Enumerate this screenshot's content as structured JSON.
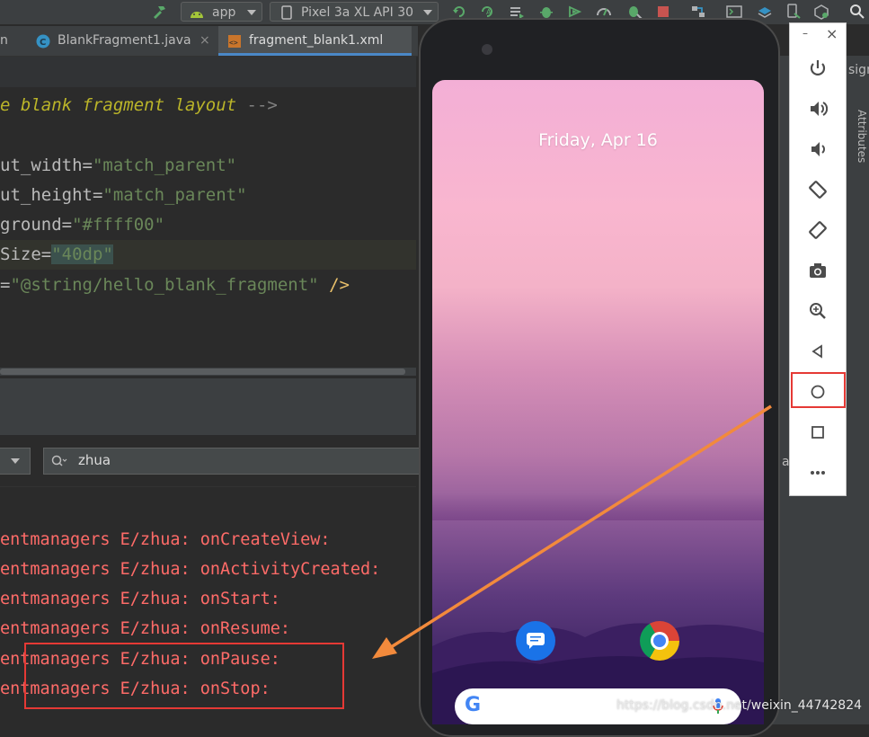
{
  "toolbar": {
    "run_config": "app",
    "device": "Pixel 3a XL API 30"
  },
  "tabs": [
    {
      "label": "n",
      "active": false
    },
    {
      "label": "BlankFragment1.java",
      "active": false
    },
    {
      "label": "fragment_blank1.xml",
      "active": true
    }
  ],
  "editor": {
    "lines": [
      {
        "c1": "e blank fragment layout",
        "c2": " -->"
      },
      {
        "a": "ut_width",
        "eq": "=",
        "s": "\"match_parent\""
      },
      {
        "a": "ut_height",
        "eq": "=",
        "s": "\"match_parent\""
      },
      {
        "a": "ground",
        "eq": "=",
        "s": "\"#ffff00\""
      },
      {
        "a": "Size",
        "eq": "=",
        "s": "\"40dp\""
      },
      {
        "a": "",
        "eq": "=",
        "s": "\"@string/hello_blank_fragment\"",
        "t": " />"
      }
    ]
  },
  "logcat": {
    "search_value": "zhua",
    "lines": [
      "entmanagers E/zhua: onCreateView:",
      "entmanagers E/zhua: onActivityCreated:",
      "entmanagers E/zhua: onStart:",
      "entmanagers E/zhua: onResume:",
      "entmanagers E/zhua: onPause:",
      "entmanagers E/zhua: onStop:"
    ]
  },
  "right_partial": {
    "design_tab": "sign",
    "attributes_label": "Attributes",
    "dropdown_letter": "a"
  },
  "phone": {
    "date": "Friday, Apr 16"
  },
  "emulator_panel": {
    "minimize": "–",
    "close": "×"
  },
  "watermark": "https://blog.csdn.net/weixin_44742824",
  "colors": {
    "highlight_box": "#e53935",
    "arrow": "#f28a3c",
    "log_error": "#ff6b68"
  }
}
